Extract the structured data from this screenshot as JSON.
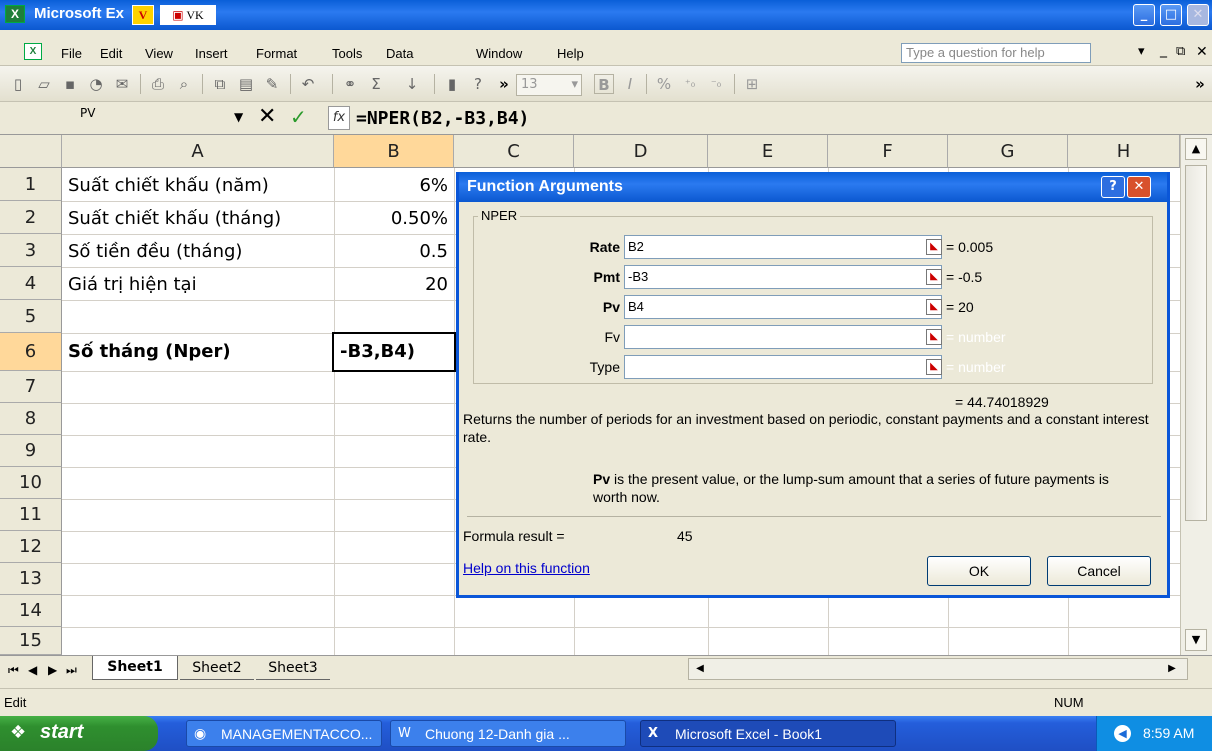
{
  "window": {
    "title": "Microsoft Ex",
    "vk_label": "VK",
    "v_label": "V",
    "min_label": "_",
    "max_label": "□",
    "close_label": "✕"
  },
  "menu": {
    "items": [
      "File",
      "Edit",
      "View",
      "Insert",
      "Format",
      "Tools",
      "Data",
      "Window",
      "Help"
    ],
    "help_placeholder": "Type a question for help",
    "font_size": "13",
    "bold": "B",
    "italic": "I",
    "percent": "%"
  },
  "formula_bar": {
    "name_box": "PV",
    "cancel": "✕",
    "enter": "✓",
    "fx": "fx",
    "formula": "=NPER(B2,-B3,B4)"
  },
  "sheet": {
    "columns": [
      "A",
      "B",
      "C",
      "D",
      "E",
      "F",
      "G",
      "H"
    ],
    "rows": [
      "1",
      "2",
      "3",
      "4",
      "5",
      "6",
      "7",
      "8",
      "9",
      "10",
      "11",
      "12",
      "13",
      "14",
      "15"
    ],
    "a1": "Suất chiết khấu (năm)",
    "b1": "6%",
    "a2": "Suất chiết khấu (tháng)",
    "b2": "0.50%",
    "a3": "Số tiền đều (tháng)",
    "b3": "0.5",
    "a4": "Giá trị hiện tại",
    "b4": "20",
    "a6": "Số tháng (Nper)",
    "b6": "-B3,B4)"
  },
  "tabs": [
    "Sheet1",
    "Sheet2",
    "Sheet3"
  ],
  "status": {
    "mode": "Edit",
    "num": "NUM"
  },
  "dialog": {
    "title": "Function Arguments",
    "help_btn": "?",
    "close_btn": "✕",
    "group": "NPER",
    "args": [
      {
        "label": "Rate",
        "value": "B2",
        "result": "= 0.005"
      },
      {
        "label": "Pmt",
        "value": "-B3",
        "result": "= -0.5"
      },
      {
        "label": "Pv",
        "value": "B4",
        "result": "= 20"
      },
      {
        "label": "Fv",
        "value": "",
        "result": "= number"
      },
      {
        "label": "Type",
        "value": "",
        "result": "= number"
      }
    ],
    "total": "= 44.74018929",
    "description": "Returns the number of periods for an investment based on periodic, constant payments and a constant interest rate.",
    "arg_name": "Pv",
    "arg_desc": "is the present value, or the lump-sum amount that a series of future payments is worth now.",
    "formula_result_label": "Formula result =",
    "formula_result_value": "45",
    "help_link": "Help on this function",
    "ok": "OK",
    "cancel": "Cancel"
  },
  "taskbar": {
    "start": "start",
    "tasks": [
      "MANAGEMENTACCO...",
      "Chuong 12-Danh gia ...",
      "Microsoft Excel - Book1"
    ],
    "time": "8:59 AM"
  }
}
